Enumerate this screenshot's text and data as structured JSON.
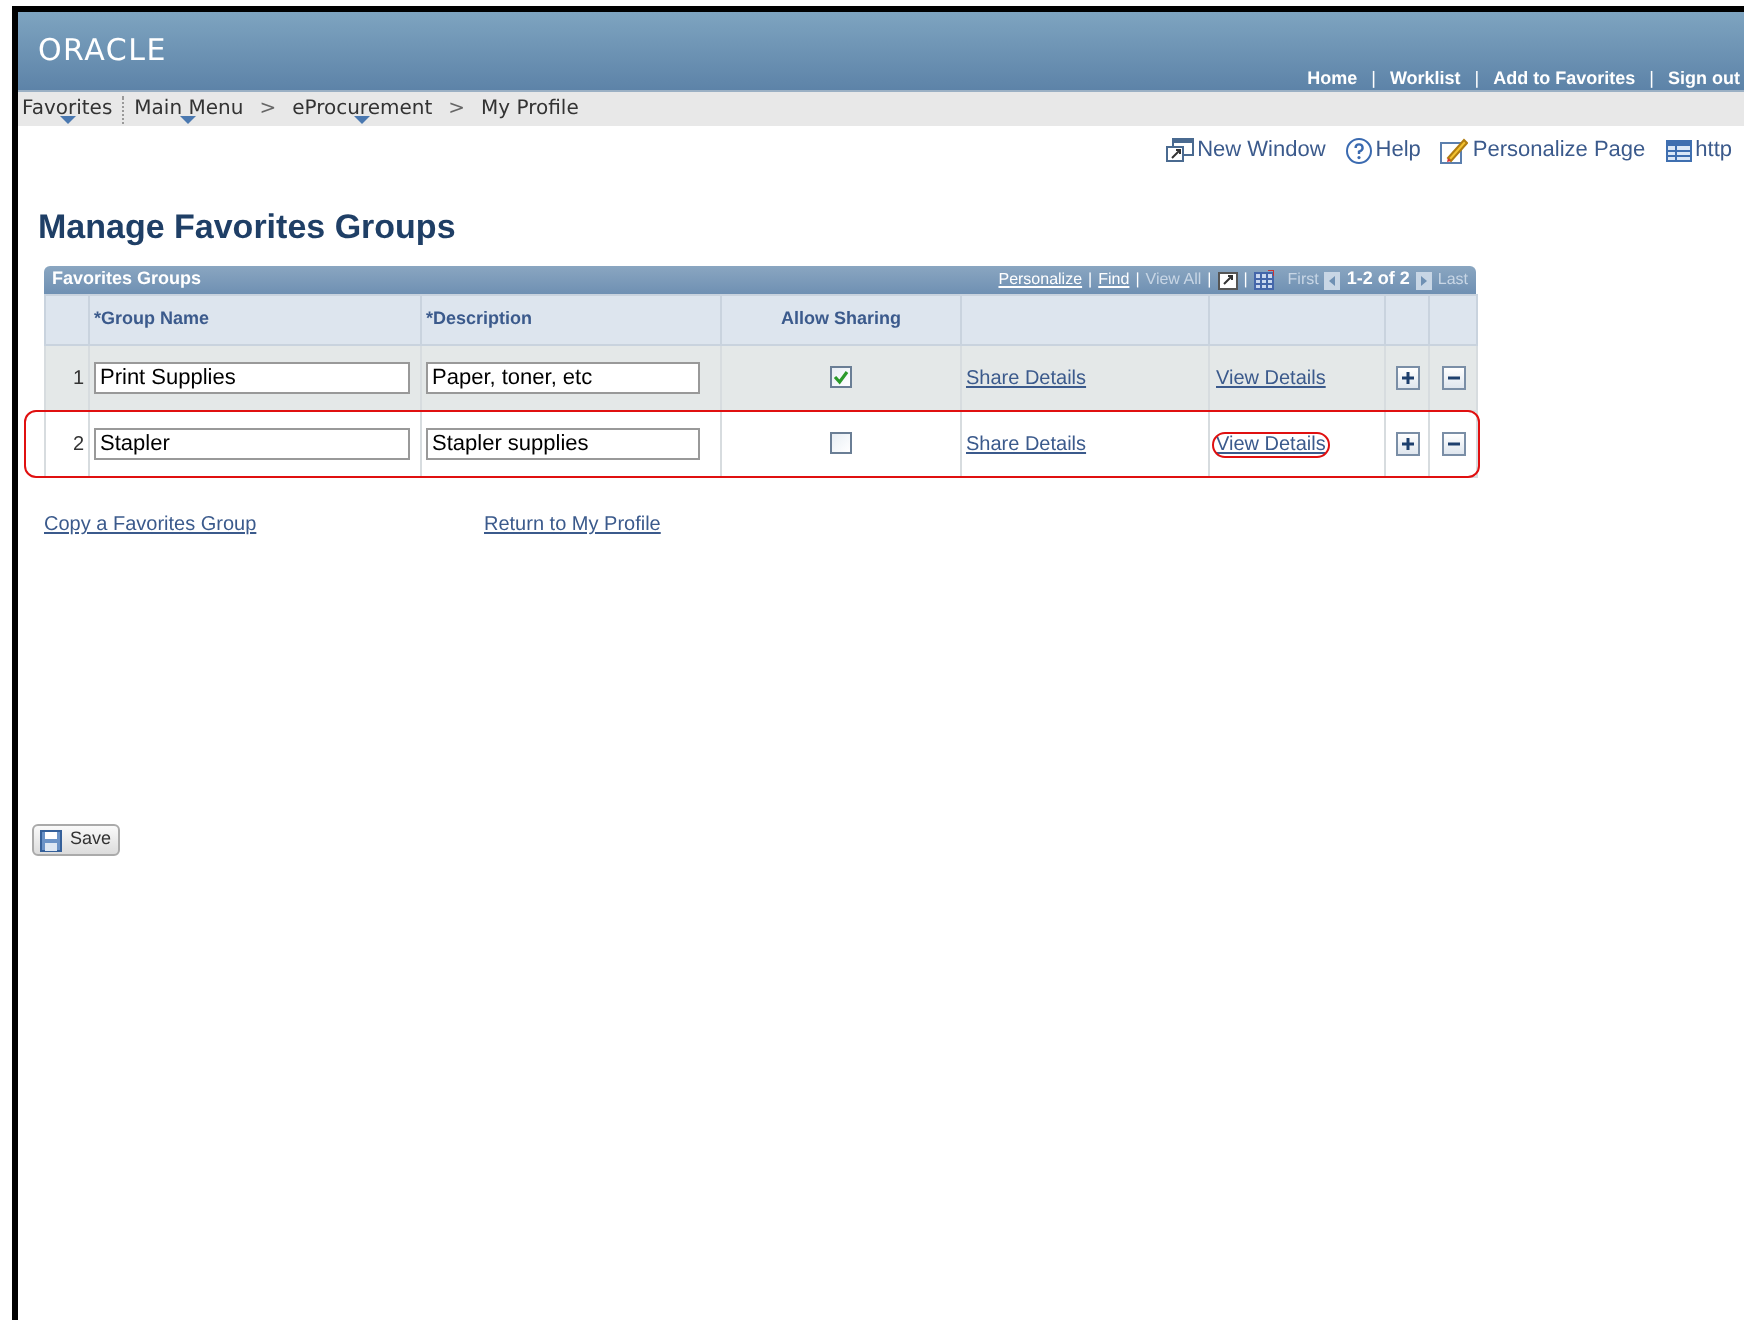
{
  "header": {
    "logo": "ORACLE",
    "links": [
      "Home",
      "Worklist",
      "Add to Favorites",
      "Sign out"
    ]
  },
  "menu": [
    {
      "label": "Favorites",
      "dropdown": true,
      "separator": "|"
    },
    {
      "label": "Main Menu",
      "dropdown": true,
      "separator": ">"
    },
    {
      "label": "eProcurement",
      "dropdown": true,
      "separator": ">"
    },
    {
      "label": "My Profile",
      "dropdown": false
    }
  ],
  "toolbar": [
    {
      "kind": "window",
      "label": "New Window"
    },
    {
      "kind": "help",
      "label": "Help"
    },
    {
      "kind": "personalize",
      "label": "Personalize Page"
    },
    {
      "kind": "http",
      "label": "http"
    }
  ],
  "page_title": "Manage Favorites Groups",
  "grid": {
    "title": "Favorites Groups",
    "nav": {
      "personalize": "Personalize",
      "find": "Find",
      "view_all": "View All",
      "first": "First",
      "range": "1-2 of 2",
      "last": "Last"
    },
    "columns": [
      "*Group Name",
      "*Description",
      "Allow Sharing"
    ],
    "rows": [
      {
        "number": "1",
        "group_name": "Print Supplies",
        "description": "Paper, toner, etc",
        "allow_sharing": true,
        "share_link": "Share Details",
        "view_link": "View Details",
        "highlighted": false,
        "view_highlighted": false
      },
      {
        "number": "2",
        "group_name": "Stapler",
        "description": "Stapler supplies",
        "allow_sharing": false,
        "share_link": "Share Details",
        "view_link": "View Details",
        "highlighted": true,
        "view_highlighted": true
      }
    ]
  },
  "links": [
    "Copy a Favorites Group",
    "Return to My Profile"
  ],
  "save_button": "Save"
}
